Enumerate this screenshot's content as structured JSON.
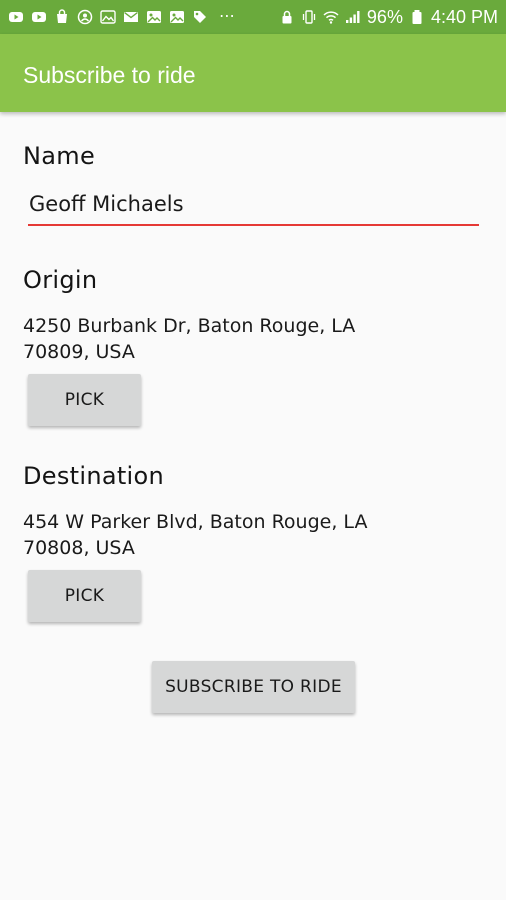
{
  "status_bar": {
    "battery_percent": "96%",
    "time": "4:40 PM",
    "overflow_dots": "⋯",
    "icons_left": [
      "youtube-icon",
      "youtube-icon",
      "bag-icon",
      "account-circle-icon",
      "photos-icon",
      "mail-icon",
      "image-icon",
      "image-icon",
      "tag-icon"
    ],
    "icons_right": [
      "lock-icon",
      "vibrate-icon",
      "wifi-icon",
      "signal-icon",
      "battery-icon"
    ],
    "colors": {
      "background": "#6aaa3c",
      "icon": "#ffffff"
    }
  },
  "app_bar": {
    "title": "Subscribe to ride",
    "color": "#8bc34a"
  },
  "form": {
    "name_label": "Name",
    "name_value": "Geoff Michaels",
    "name_underline_color": "#e53935",
    "origin_label": "Origin",
    "origin_address_line1": "4250 Burbank Dr, Baton Rouge, LA",
    "origin_address_line2": "70809, USA",
    "origin_pick_label": "PICK",
    "destination_label": "Destination",
    "destination_address_line1": "454 W Parker Blvd, Baton Rouge, LA",
    "destination_address_line2": "70808, USA",
    "destination_pick_label": "PICK",
    "subscribe_label": "SUBSCRIBE TO RIDE"
  }
}
